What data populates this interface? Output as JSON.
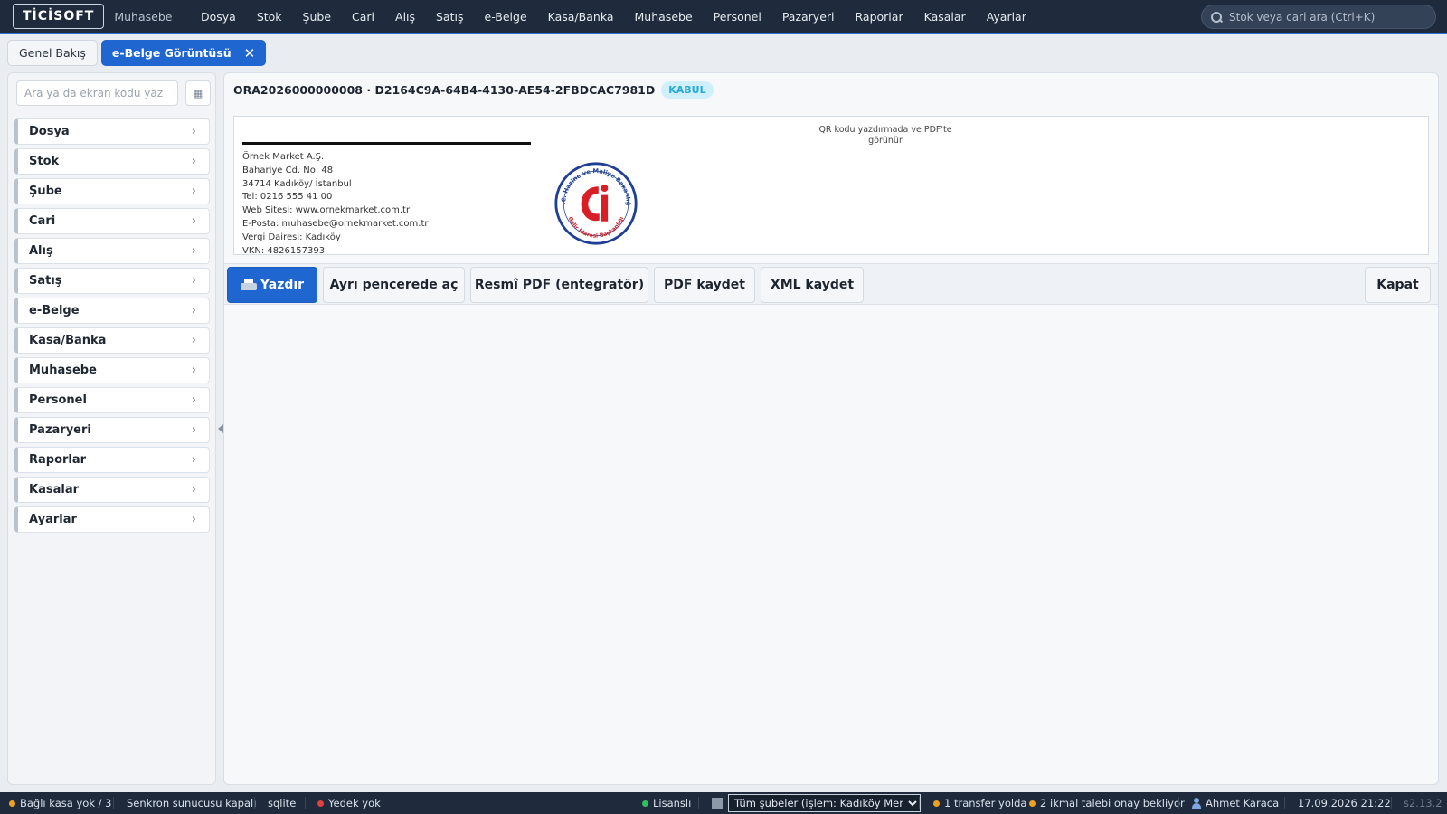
{
  "header": {
    "logo": "TİCİSOFT",
    "app_name": "Muhasebe",
    "nav": [
      "Dosya",
      "Stok",
      "Şube",
      "Cari",
      "Alış",
      "Satış",
      "e-Belge",
      "Kasa/Banka",
      "Muhasebe",
      "Personel",
      "Pazaryeri",
      "Raporlar",
      "Kasalar",
      "Ayarlar"
    ],
    "search_placeholder": "Stok veya cari ara (Ctrl+K)"
  },
  "tabs": {
    "overview": "Genel Bakış",
    "active": "e-Belge Görüntüsü",
    "close": "✕"
  },
  "sidebar": {
    "search_placeholder": "Ara ya da ekran kodu yaz",
    "grid_button": "▦",
    "items": [
      "Dosya",
      "Stok",
      "Şube",
      "Cari",
      "Alış",
      "Satış",
      "e-Belge",
      "Kasa/Banka",
      "Muhasebe",
      "Personel",
      "Pazaryeri",
      "Raporlar",
      "Kasalar",
      "Ayarlar"
    ],
    "chevron": "›"
  },
  "document": {
    "title": "ORA2026000000008 · D2164C9A-64B4-4130-AE54-2FBDCAC7981D",
    "status": "KABUL",
    "status_color": "#27a9d6",
    "company_lines": [
      "Örnek Market A.Ş.",
      "Bahariye Cd. No: 48",
      "34714 Kadıköy/ İstanbul",
      "Tel: 0216 555 41 00",
      "Web Sitesi: www.ornekmarket.com.tr",
      "E-Posta: muhasebe@ornekmarket.com.tr",
      "Vergi Dairesi: Kadıköy",
      "VKN: 4826157393"
    ],
    "qr_note": "QR kodu yazdırmada ve PDF'te görünür",
    "seal_top_text": "T.C. Hazine ve Maliye Bakanlığı",
    "seal_bottom_text": "Gelir İdaresi Başkanlığı"
  },
  "actions": {
    "print": "Yazdır",
    "open_window": "Ayrı pencerede aç",
    "official_pdf": "Resmî PDF (entegratör)",
    "save_pdf": "PDF kaydet",
    "save_xml": "XML kaydet",
    "close": "Kapat"
  },
  "status": {
    "kasa": "Bağlı kasa yok / 3",
    "sync": "Senkron sunucusu kapalı",
    "db": "sqlite",
    "backup": "Yedek yok",
    "license": "Lisanslı",
    "branch": "Tüm şubeler (işlem: Kadıköy Merkez)",
    "transfer": "1 transfer yolda",
    "ikmal": "2 ikmal talebi onay bekliyor",
    "user": "Ahmet Karaca",
    "datetime": "17.09.2026 21:22",
    "version": "s2.13.2",
    "colors": {
      "warning": "#f0a020",
      "error": "#e04040",
      "ok": "#2fbf5f"
    }
  }
}
